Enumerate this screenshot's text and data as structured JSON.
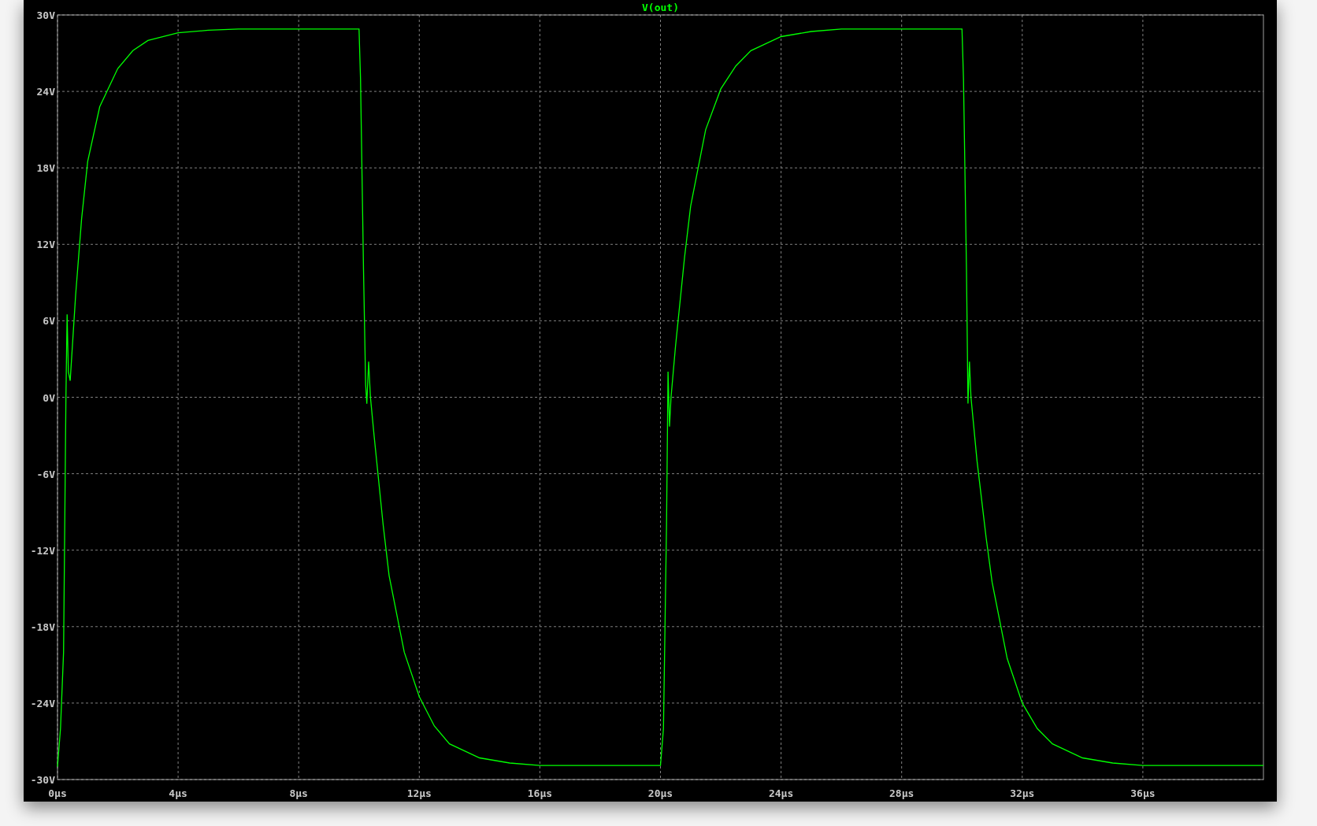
{
  "plot": {
    "chart_data": {
      "type": "line",
      "grid": true,
      "title": "V(out)",
      "xlim": [
        0,
        40
      ],
      "ylim": [
        -30,
        30
      ],
      "xticks": [
        {
          "value": 0,
          "label": "0µs"
        },
        {
          "value": 4,
          "label": "4µs"
        },
        {
          "value": 8,
          "label": "8µs"
        },
        {
          "value": 12,
          "label": "12µs"
        },
        {
          "value": 16,
          "label": "16µs"
        },
        {
          "value": 20,
          "label": "20µs"
        },
        {
          "value": 24,
          "label": "24µs"
        },
        {
          "value": 28,
          "label": "28µs"
        },
        {
          "value": 32,
          "label": "32µs"
        },
        {
          "value": 36,
          "label": "36µs"
        }
      ],
      "yticks": [
        {
          "value": 30,
          "label": "30V"
        },
        {
          "value": 24,
          "label": "24V"
        },
        {
          "value": 18,
          "label": "18V"
        },
        {
          "value": 12,
          "label": "12V"
        },
        {
          "value": 6,
          "label": "6V"
        },
        {
          "value": 0,
          "label": "0V"
        },
        {
          "value": -6,
          "label": "-6V"
        },
        {
          "value": -12,
          "label": "-12V"
        },
        {
          "value": -18,
          "label": "-18V"
        },
        {
          "value": -24,
          "label": "-24V"
        },
        {
          "value": -30,
          "label": "-30V"
        }
      ],
      "x": [
        0,
        0.1,
        0.2,
        0.28,
        0.32,
        0.36,
        0.42,
        0.6,
        0.8,
        1.0,
        1.4,
        2.0,
        2.5,
        3.0,
        4.0,
        5.0,
        6.0,
        10.0,
        10.05,
        10.15,
        10.22,
        10.26,
        10.32,
        10.38,
        10.5,
        10.8,
        11.0,
        11.5,
        12.0,
        12.5,
        13.0,
        14.0,
        15.0,
        16.0,
        20.0,
        20.1,
        20.2,
        20.25,
        20.3,
        20.35,
        20.5,
        20.8,
        21.0,
        21.5,
        22.0,
        22.5,
        23.0,
        24.0,
        25.0,
        26.0,
        30.0,
        30.05,
        30.15,
        30.2,
        30.25,
        30.3,
        30.5,
        30.8,
        31.0,
        31.5,
        32.0,
        32.5,
        33.0,
        34.0,
        35.0,
        36.0,
        40.0
      ],
      "series": [
        {
          "color": "#00ff00",
          "values": [
            -29,
            -26,
            -20,
            0,
            6.5,
            2,
            1.3,
            8,
            14,
            18.5,
            22.8,
            25.8,
            27.2,
            28,
            28.6,
            28.8,
            28.9,
            28.9,
            25,
            10,
            1,
            -0.5,
            2.8,
            0,
            -3,
            -10,
            -14,
            -20,
            -23.5,
            -25.8,
            -27.2,
            -28.3,
            -28.7,
            -28.9,
            -28.9,
            -26,
            -10,
            2,
            -2.3,
            0,
            4,
            11,
            15,
            21,
            24.2,
            26,
            27.2,
            28.3,
            28.7,
            28.9,
            28.9,
            25,
            10,
            -0.5,
            2.8,
            0,
            -5,
            -11,
            -14.5,
            -20.5,
            -24,
            -26,
            -27.2,
            -28.3,
            -28.7,
            -28.9,
            -28.9
          ]
        }
      ]
    }
  }
}
